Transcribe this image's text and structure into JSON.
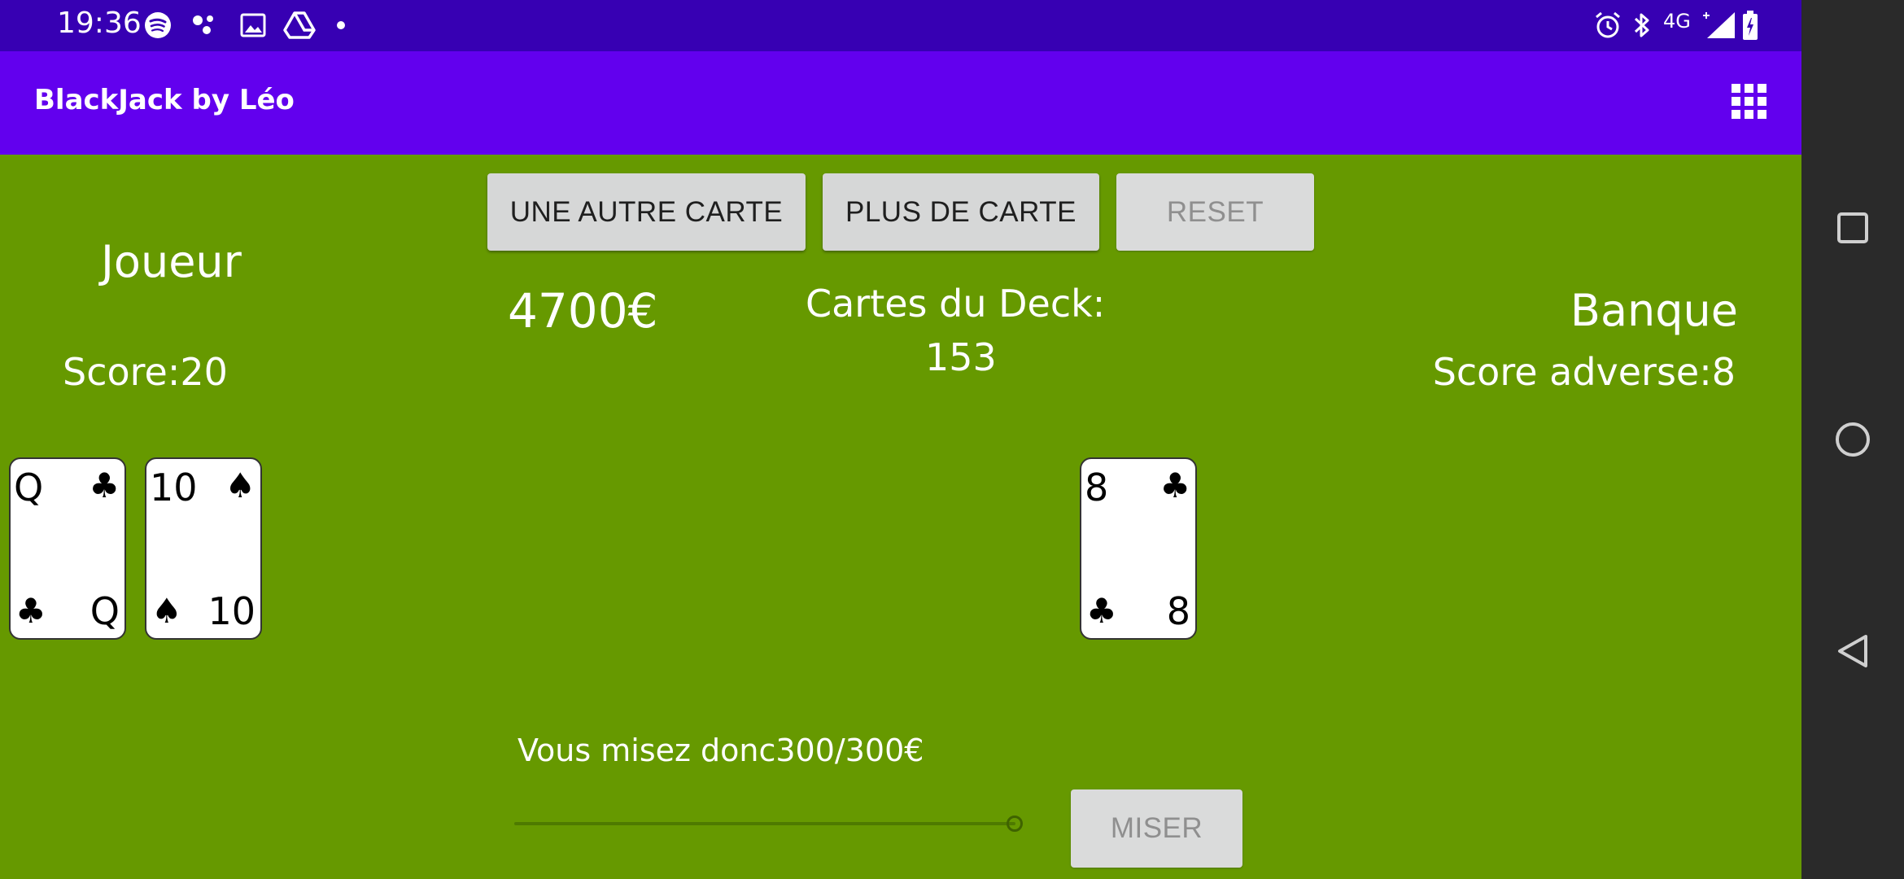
{
  "status_bar": {
    "time": "19:36",
    "network": "4G"
  },
  "app_bar": {
    "title": "BlackJack by Léo",
    "menu_icon": "grid-icon"
  },
  "buttons": {
    "another_card": "UNE AUTRE CARTE",
    "no_more_card": "PLUS DE CARTE",
    "reset": "RESET",
    "bet": "MISER"
  },
  "player": {
    "label": "Joueur",
    "score": "Score:20",
    "cards": [
      {
        "rank": "Q",
        "suit": "♣"
      },
      {
        "rank": "10",
        "suit": "♠"
      }
    ]
  },
  "money": "4700€",
  "deck": {
    "label": "Cartes du Deck:",
    "count": "153"
  },
  "bank": {
    "label": "Banque",
    "score": "Score adverse:8",
    "cards": [
      {
        "rank": "8",
        "suit": "♣"
      }
    ]
  },
  "bet": {
    "text": "Vous misez donc300/300€",
    "value": 300,
    "max": 300
  },
  "colors": {
    "status_bar": "#3700b3",
    "app_bar": "#6200ee",
    "table": "#669900",
    "nav_bar": "#2a2a2a",
    "button": "#d6d7d7"
  }
}
